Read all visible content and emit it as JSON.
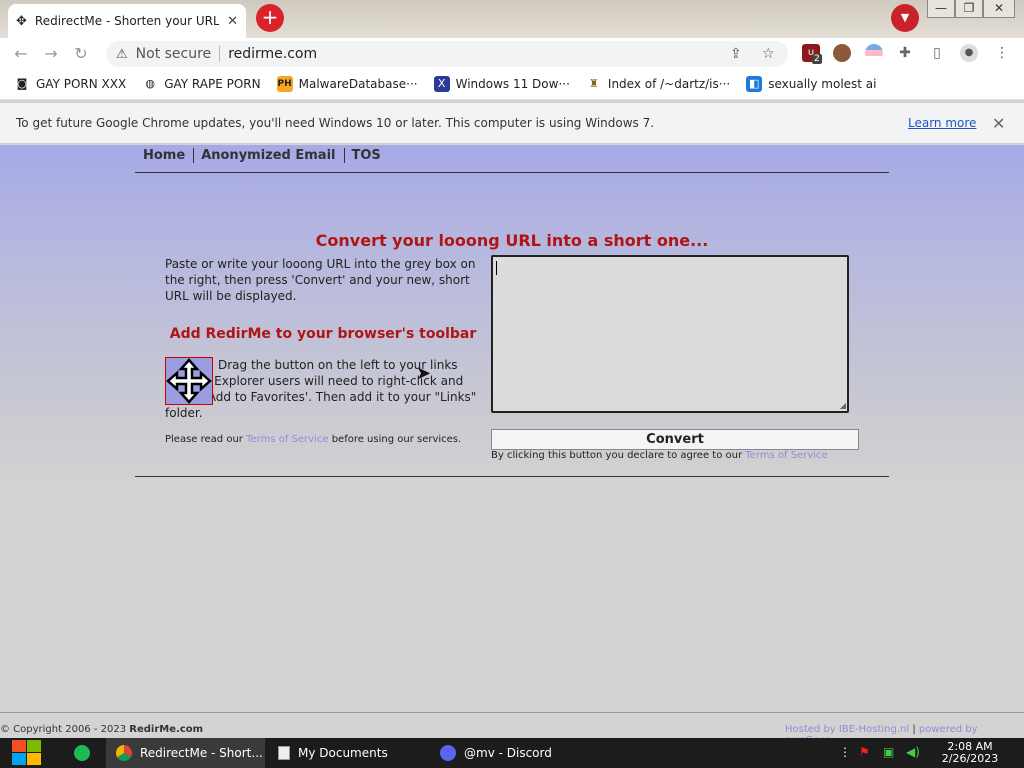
{
  "browser": {
    "tab_title": "RedirectMe - Shorten your URL",
    "tab_close": "✕",
    "new_tab": "+",
    "address": {
      "security_label": "Not secure",
      "url": "redirme.com"
    },
    "window_controls": [
      "—",
      "❐",
      "✕"
    ],
    "bookmarks": [
      {
        "label": "GAY PORN XXX",
        "icon": "robot-icon"
      },
      {
        "label": "GAY RAPE PORN",
        "icon": "globe-icon"
      },
      {
        "label": "MalwareDatabase···",
        "icon": "ph-icon"
      },
      {
        "label": "Windows 11 Dow···",
        "icon": "x-icon"
      },
      {
        "label": "Index of /~dartz/is···",
        "icon": "folder-icon"
      },
      {
        "label": "sexually molest ai",
        "icon": "ai-icon"
      }
    ],
    "extension_badge": "2",
    "infobar": {
      "message": "To get future Google Chrome updates, you'll need Windows 10 or later. This computer is using Windows 7.",
      "link": "Learn more",
      "close": "✕"
    }
  },
  "site": {
    "menu": [
      "Home",
      "Anonymized Email",
      "TOS"
    ],
    "headline": "Convert your looong URL into a short one...",
    "instructions": "Paste or write your looong URL into the grey box on the right, then press 'Convert' and your new, short URL will be displayed.",
    "toolbar_heading": "Add RedirMe to your browser's toolbar",
    "drag_text": "Drag the button on the left to your links toolbar. Explorer users will need to right-click and select 'Add to Favorites'. Then add it to your \"Links\" folder.",
    "notice_prefix": "Please read our",
    "notice_link": "Terms of Service",
    "notice_suffix": "before using our services.",
    "url_box_value": "",
    "convert_label": "Convert",
    "declare_prefix": "By clicking this button you declare to agree to our",
    "declare_link": "Terms of Service",
    "footer": {
      "copyright_prefix": "© Copyright 2006 - 2023",
      "copyright_brand": "RedirMe.com",
      "hosted_by": "Hosted by IBE-Hosting.nl",
      "separator": "|",
      "powered_by": "powered by cmsGear"
    }
  },
  "taskbar": {
    "items": [
      {
        "label": "RedirectMe - Short...",
        "icon": "chrome-icon",
        "active": true
      },
      {
        "label": "My Documents",
        "icon": "folder-icon",
        "active": false
      },
      {
        "label": "@mv - Discord",
        "icon": "discord-icon",
        "active": false
      }
    ],
    "time": "2:08 AM",
    "date": "2/26/2023"
  },
  "colors": {
    "accent_red": "#b01515",
    "link_purple": "#8c8fd8",
    "page_top": "#a6a9e6"
  }
}
